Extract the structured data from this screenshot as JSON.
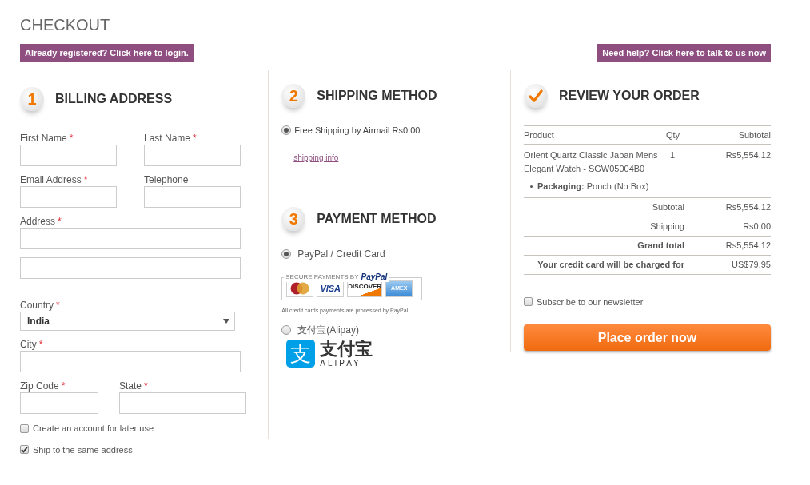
{
  "page_title": "CHECKOUT",
  "top_links": [
    {
      "label": "Already registered? Click here to login."
    },
    {
      "label": "Need help? Click here to talk to us now"
    }
  ],
  "billing": {
    "badge": {
      "kind": "number",
      "text": "1"
    },
    "title": "BILLING ADDRESS",
    "rows": [
      {
        "kind": "pair",
        "fields": [
          {
            "kind": "input",
            "label": "First Name",
            "required_mark": "*"
          },
          {
            "kind": "input",
            "label": "Last Name",
            "required_mark": "*"
          }
        ]
      },
      {
        "kind": "pair",
        "fields": [
          {
            "kind": "input",
            "label": "Email Address",
            "required_mark": "*"
          },
          {
            "kind": "input",
            "label": "Telephone"
          }
        ]
      },
      {
        "kind": "single",
        "fields": [
          {
            "kind": "input",
            "label": "Address",
            "required_mark": "*"
          }
        ]
      },
      {
        "kind": "single",
        "fields": [
          {
            "kind": "input"
          }
        ]
      },
      {
        "kind": "single",
        "fields": [
          {
            "kind": "select",
            "label": "Country",
            "required_mark": "*",
            "value": "India"
          }
        ]
      },
      {
        "kind": "single",
        "fields": [
          {
            "kind": "input",
            "label": "City",
            "required_mark": "*"
          }
        ]
      },
      {
        "kind": "uneven",
        "fields": [
          {
            "kind": "input",
            "label": "Zip Code",
            "required_mark": "*"
          },
          {
            "kind": "input",
            "label": "State",
            "required_mark": "*"
          }
        ]
      }
    ],
    "checkboxes": [
      {
        "label": "Create an account for later use",
        "checked": false
      }
    ]
  },
  "ship_same": {
    "label": "Ship to the same address",
    "checked": true
  },
  "shipping": {
    "badge": {
      "kind": "number",
      "text": "2"
    },
    "title": "SHIPPING METHOD",
    "options": [
      {
        "label": "Free Shipping by Airmail Rs0.00",
        "selected": true
      }
    ],
    "link": "shipping info"
  },
  "payment": {
    "badge": {
      "kind": "number",
      "text": "3"
    },
    "title": "PAYMENT METHOD",
    "methods": [
      {
        "kind": "paypal",
        "label": "PayPal / Credit Card",
        "selected": true,
        "badge": {
          "caption": "SECURE PAYMENTS BY",
          "brand": "PayPal",
          "cards": [
            {
              "kind": "mastercard"
            },
            {
              "kind": "visa",
              "label": "VISA"
            },
            {
              "kind": "discover",
              "label": "DISCOVER"
            },
            {
              "kind": "amex",
              "label": "AMEX"
            }
          ]
        },
        "note": "All credit cards payments are processed by PayPal."
      },
      {
        "kind": "alipay",
        "label": "支付宝(Alipay)",
        "selected": false,
        "logo": {
          "mark": "支",
          "name": "支付宝",
          "latin": "ALIPAY"
        }
      }
    ]
  },
  "review": {
    "badge": {
      "kind": "check"
    },
    "title": "REVIEW YOUR ORDER",
    "columns": [
      "Product",
      "Qty",
      "Subtotal"
    ],
    "items": [
      {
        "product": "Orient Quartz Classic Japan Mens Elegant Watch - SGW05004B0",
        "qty": "1",
        "subtotal": "Rs5,554.12",
        "options": [
          {
            "label": "Packaging:",
            "value": "Pouch (No Box)"
          }
        ]
      }
    ],
    "totals": [
      {
        "label": "Subtotal",
        "value": "Rs5,554.12",
        "emphasis": false
      },
      {
        "label": "Shipping",
        "value": "Rs0.00",
        "emphasis": false
      },
      {
        "label": "Grand total",
        "value": "Rs5,554.12",
        "emphasis": true
      },
      {
        "label": "Your credit card will be charged for",
        "value": "US$79.95",
        "emphasis": true
      }
    ],
    "newsletter": {
      "label": "Subscribe to our newsletter",
      "checked": false
    },
    "submit": "Place order now"
  }
}
